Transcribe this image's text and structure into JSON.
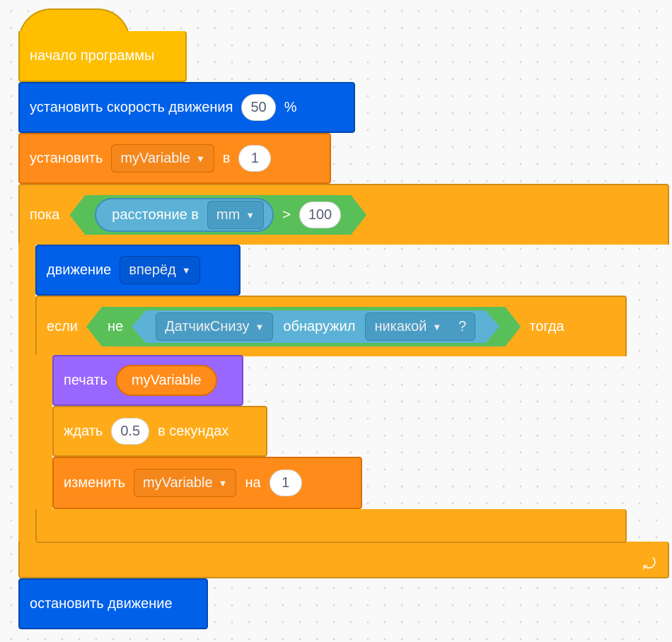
{
  "blocks": {
    "start": {
      "label": "начало программы"
    },
    "set_speed": {
      "label": "установить скорость движения",
      "value": "50",
      "unit": "%"
    },
    "set_var": {
      "label": "установить",
      "variable": "myVariable",
      "to": "в",
      "value": "1"
    },
    "while": {
      "label": "пока",
      "reporter_label": "расстояние в",
      "unit": "mm",
      "operator": ">",
      "value": "100"
    },
    "move": {
      "label": "движение",
      "direction": "вперёд"
    },
    "if": {
      "label": "если",
      "not": "не",
      "sensor": "ДатчикСнизу",
      "detected": "обнаружил",
      "color": "никакой",
      "question": "?",
      "then": "тогда"
    },
    "print": {
      "label": "печать",
      "variable": "myVariable"
    },
    "wait": {
      "label": "ждать",
      "value": "0.5",
      "unit": "в секундах"
    },
    "change": {
      "label": "изменить",
      "variable": "myVariable",
      "by": "на",
      "value": "1"
    },
    "stop": {
      "label": "остановить движение"
    }
  },
  "icons": {
    "dropdown": "caret-down-icon",
    "loop_arrow": "loop-arrow-icon"
  },
  "colors": {
    "events": "#ffbf00",
    "motion": "#0060e8",
    "variables": "#ff8c1a",
    "control": "#ffab19",
    "operators": "#59c059",
    "sensing": "#5cb1d6",
    "looks": "#9966ff"
  }
}
